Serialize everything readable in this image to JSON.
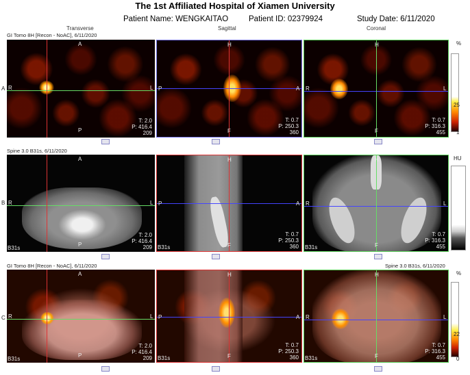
{
  "header": {
    "title": "The 1st Affiliated Hospital of Xiamen University",
    "patient_name": "Patient Name: WENGKAITAO",
    "patient_id": "Patient ID: 02379924",
    "study_date": "Study Date: 6/11/2020"
  },
  "views": {
    "transverse": "Transverse",
    "sagittal": "Sagittal",
    "coronal": "Coronal"
  },
  "rows": {
    "a": {
      "letter": "A",
      "series": "GI Tomo 8H [Recon - NoAC], 6/11/2020",
      "scale_unit": "%",
      "scale_value": "25",
      "scale_min": "1"
    },
    "b": {
      "letter": "B",
      "series": "Spine  3.0  B31s, 6/11/2020",
      "scale_unit": "HU"
    },
    "c": {
      "letter": "C",
      "series_left": "GI Tomo 8H [Recon - NoAC], 6/11/2020",
      "series_right": "Spine  3.0  B31s, 6/11/2020",
      "scale_unit": "%",
      "scale_value": "22",
      "scale_min": "0"
    }
  },
  "orient": {
    "a": "A",
    "p": "P",
    "r": "R",
    "l": "L",
    "h": "H",
    "f": "F"
  },
  "ct_kernel": "B31s",
  "readouts": {
    "transverse": {
      "t": "T: 2.0",
      "p": "P: 416.4",
      "slice": "209"
    },
    "sagittal": {
      "t": "T: 0.7",
      "p": "P: 250.3",
      "slice": "360"
    },
    "coronal": {
      "t": "T: 0.7",
      "p": "P: 316.3",
      "slice": "455"
    }
  }
}
